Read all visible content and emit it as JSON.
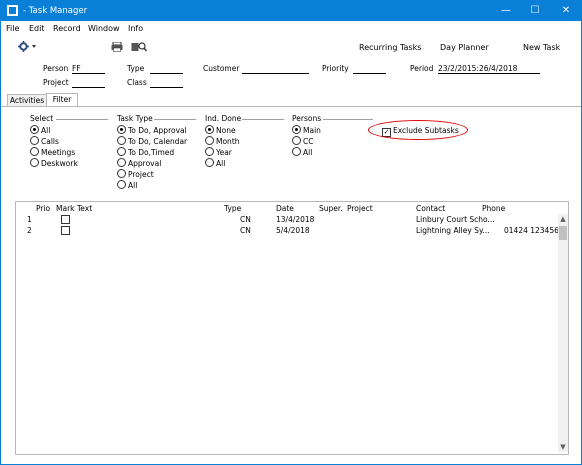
{
  "window": {
    "title": "- Task Manager",
    "controls": {
      "minimize": "—",
      "maximize": "☐",
      "close": "✕"
    }
  },
  "menu": {
    "items": [
      "File",
      "Edit",
      "Record",
      "Window",
      "Info"
    ]
  },
  "toolbar": {
    "gear_icon": "gear-icon",
    "print_icon": "printer-icon",
    "search_icon": "search-icon",
    "recurring_tasks": "Recurring Tasks",
    "day_planner": "Day Planner",
    "new_task": "New Task"
  },
  "header": {
    "person_label": "Person",
    "person_value": "FF",
    "type_label": "Type",
    "type_value": "",
    "customer_label": "Customer",
    "customer_value": "",
    "priority_label": "Priority",
    "priority_value": "",
    "period_label": "Period",
    "period_value": "23/2/2015:26/4/2018",
    "project_label": "Project",
    "project_value": "",
    "class_label": "Class",
    "class_value": ""
  },
  "tabs": [
    {
      "label": "Activities",
      "active": false
    },
    {
      "label": "Filter",
      "active": true
    }
  ],
  "filter": {
    "select": {
      "title": "Select",
      "options": [
        "All",
        "Calls",
        "Meetings",
        "Deskwork"
      ],
      "selected": 0
    },
    "task_type": {
      "title": "Task Type",
      "options": [
        "To Do, Approval",
        "To Do, Calendar",
        "To Do,Timed",
        "Approval",
        "Project",
        "All"
      ],
      "selected": 0
    },
    "ind_done": {
      "title": "Ind. Done",
      "options": [
        "None",
        "Month",
        "Year",
        "All"
      ],
      "selected": 0
    },
    "persons": {
      "title": "Persons",
      "options": [
        "Main",
        "CC",
        "All"
      ],
      "selected": 0
    },
    "exclude_subtasks": {
      "label": "Exclude Subtasks",
      "checked": true,
      "check_glyph": "✓"
    }
  },
  "grid": {
    "columns": {
      "prio": "Prio",
      "mark": "Mark",
      "text": "Text",
      "type": "Type",
      "date": "Date",
      "super": "Super.",
      "project": "Project",
      "contact": "Contact",
      "phone": "Phone"
    },
    "rows": [
      {
        "prio": "1",
        "mark": false,
        "text": "",
        "type": "CN",
        "date": "13/4/2018",
        "super": "",
        "project": "",
        "contact": "Linbury Court Scho...",
        "phone": ""
      },
      {
        "prio": "2",
        "mark": false,
        "text": "",
        "type": "CN",
        "date": "5/4/2018",
        "super": "",
        "project": "",
        "contact": "Lightning Alley Sy...",
        "phone": "01424 123456"
      }
    ],
    "scroll_up": "▲",
    "scroll_down": "▼"
  },
  "colors": {
    "titlebar": "#0a7fd8",
    "highlight": "#e00000"
  }
}
